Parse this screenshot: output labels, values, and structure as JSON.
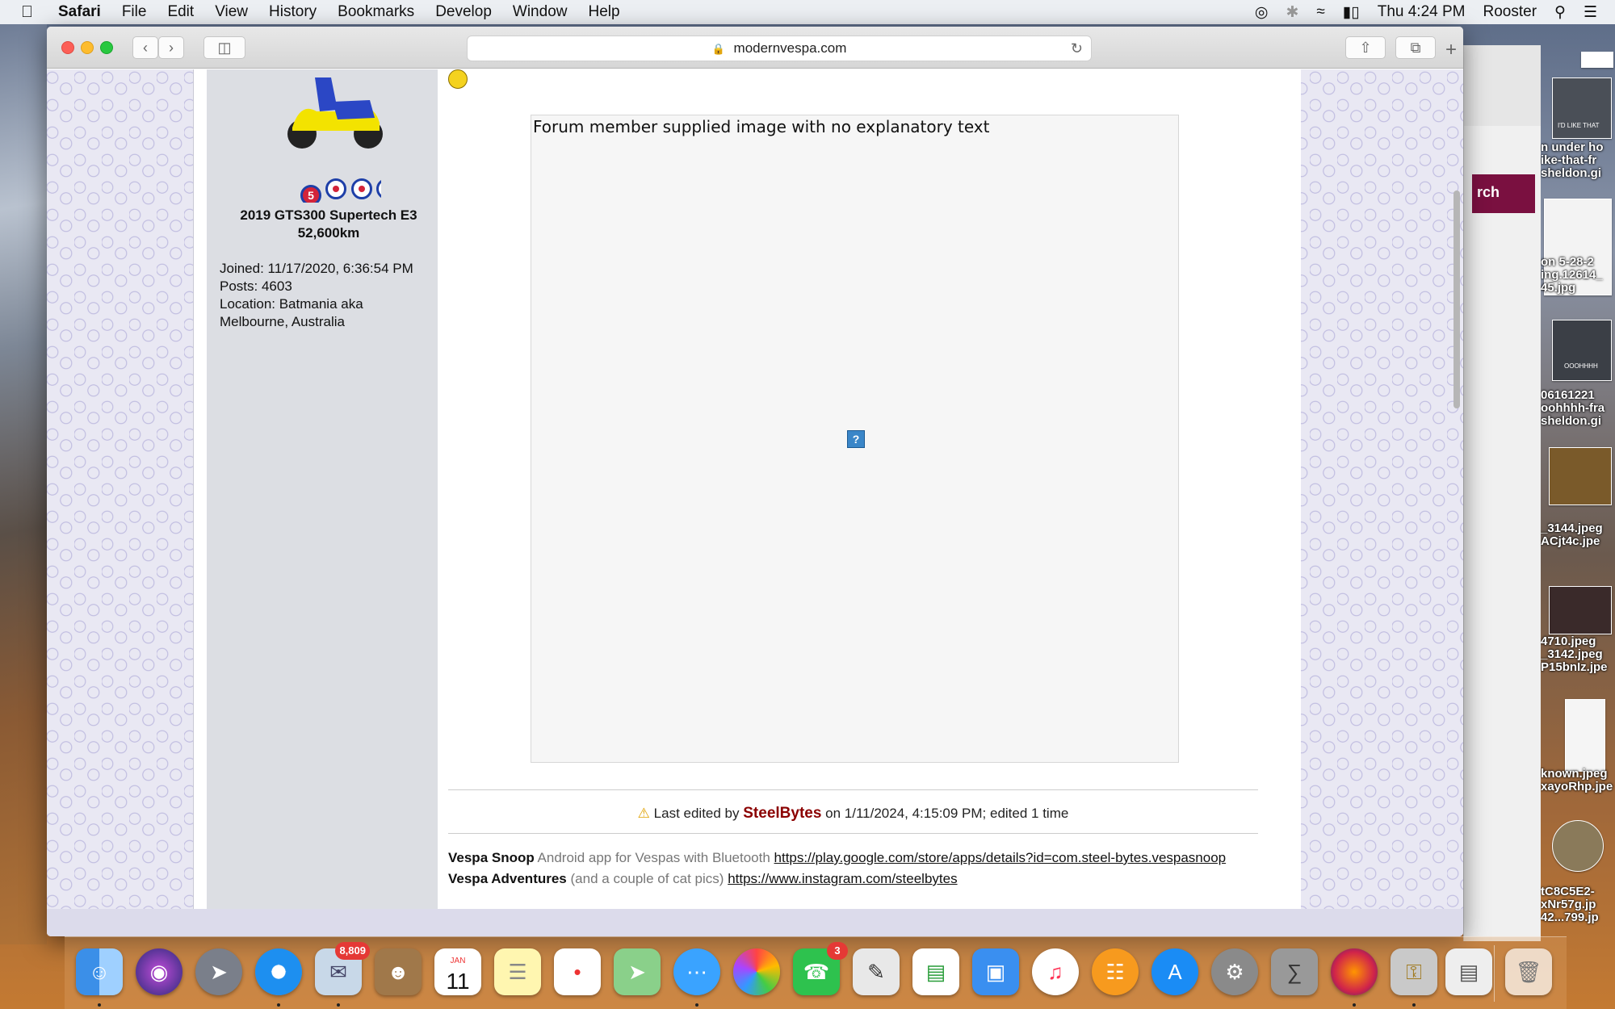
{
  "menubar": {
    "app": "Safari",
    "items": [
      "File",
      "Edit",
      "View",
      "History",
      "Bookmarks",
      "Develop",
      "Window",
      "Help"
    ],
    "clock": "Thu 4:24 PM",
    "user": "Rooster"
  },
  "browser": {
    "url": "modernvespa.com",
    "search_fragment": "rch"
  },
  "profile": {
    "badge_number": "5",
    "bike_line1": "2019 GTS300 Supertech E3",
    "bike_line2": "52,600km",
    "joined": "Joined: 11/17/2020, 6:36:54 PM",
    "posts": "Posts: 4603",
    "location_line1": "Location: Batmania aka",
    "location_line2": "Melbourne, Australia"
  },
  "post": {
    "image_alt": "Forum member supplied image with no explanatory text",
    "edited_prefix": "Last edited by",
    "edited_user": "SteelBytes",
    "edited_suffix": "on 1/11/2024, 4:15:09 PM; edited 1 time"
  },
  "signature": {
    "line1_title": "Vespa Snoop",
    "line1_desc": "Android app for Vespas with Bluetooth",
    "line1_link": "https://play.google.com/store/apps/details?id=com.steel-bytes.vespasnoop",
    "line2_title": "Vespa Adventures",
    "line2_desc": "(and a couple of cat pics)",
    "line2_link": "https://www.instagram.com/steelbytes"
  },
  "desktop_files": [
    {
      "text": "n under ho"
    },
    {
      "text": "ike-that-fr"
    },
    {
      "text": "sheldon.gi"
    },
    {
      "text": "on 5-28-2"
    },
    {
      "text": "ing.12614_"
    },
    {
      "text": "45.jpg"
    },
    {
      "text": "OOOHHHH"
    },
    {
      "text": "06161221"
    },
    {
      "text": "oohhhh-fra"
    },
    {
      "text": "sheldon.gi"
    },
    {
      "text": "_3144.jpeg"
    },
    {
      "text": "ACjt4c.jpe"
    },
    {
      "text": "4710.jpeg"
    },
    {
      "text": "_3142.jpeg"
    },
    {
      "text": "P15bnIz.jpe"
    },
    {
      "text": "known.jpeg"
    },
    {
      "text": "xayoRhp.jpe"
    },
    {
      "text": "tC8C5E2-"
    },
    {
      "text": "xNr57g.jp"
    },
    {
      "text": "42...799.jp"
    }
  ],
  "thumb_captions": {
    "likethat": "I'D LIKE THAT"
  },
  "dock": {
    "mail_badge": "8,809",
    "facetime_badge": "3",
    "calendar_month": "JAN",
    "calendar_day": "11"
  },
  "colors": {
    "accent_user": "#8b0000",
    "menubar_bg": "#eceff3",
    "sidebar_bg": "#dcdee3"
  }
}
